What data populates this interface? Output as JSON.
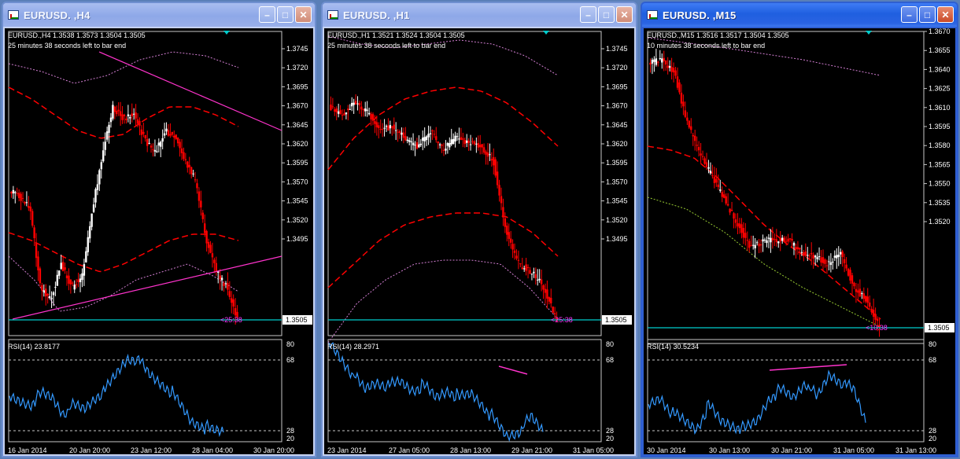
{
  "windows": [
    {
      "title": "EURUSD. ,H4",
      "active": false,
      "ohlc": "EURUSD.,H4  1.3538 1.3573 1.3504 1.3505",
      "status": "25 minutes 38 seconds left to bar end",
      "price_label": "1.3505",
      "timer": "<25:38",
      "rsi_label": "RSI(14) 23.8177",
      "rsi_levels": [
        "80",
        "68",
        "28",
        "20"
      ],
      "price_ticks": [
        "1.3745",
        "1.3720",
        "1.3695",
        "1.3670",
        "1.3645",
        "1.3620",
        "1.3595",
        "1.3570",
        "1.3545",
        "1.3520",
        "1.3495"
      ],
      "time_ticks": [
        "16 Jan 2014",
        "20 Jan 20:00",
        "23 Jan 12:00",
        "28 Jan 04:00",
        "30 Jan 20:00"
      ]
    },
    {
      "title": "EURUSD. ,H1",
      "active": false,
      "ohlc": "EURUSD.,H1  1.3521 1.3524 1.3504 1.3505",
      "status": "25 minutes 38 seconds left to bar end",
      "price_label": "1.3505",
      "timer": "<25:38",
      "rsi_label": "RSI(14) 28.2971",
      "rsi_levels": [
        "80",
        "68",
        "28",
        "20"
      ],
      "price_ticks": [
        "1.3745",
        "1.3720",
        "1.3695",
        "1.3670",
        "1.3645",
        "1.3620",
        "1.3595",
        "1.3570",
        "1.3545",
        "1.3520",
        "1.3495"
      ],
      "time_ticks": [
        "23 Jan 2014",
        "27 Jan 05:00",
        "28 Jan 13:00",
        "29 Jan 21:00",
        "31 Jan 05:00"
      ]
    },
    {
      "title": "EURUSD. ,M15",
      "active": true,
      "ohlc": "EURUSD.,M15  1.3516 1.3517 1.3504 1.3505",
      "status": "10 minutes 38 seconds left to bar end",
      "price_label": "1.3505",
      "timer": "<10:38",
      "rsi_label": "RSI(14) 30.5234",
      "rsi_levels": [
        "80",
        "68",
        "28",
        "20"
      ],
      "price_ticks": [
        "1.3670",
        "1.3655",
        "1.3640",
        "1.3625",
        "1.3610",
        "1.3595",
        "1.3580",
        "1.3565",
        "1.3550",
        "1.3535",
        "1.3520"
      ],
      "time_ticks": [
        "30 Jan 2014",
        "30 Jan 13:00",
        "30 Jan 21:00",
        "31 Jan 05:00",
        "31 Jan 13:00"
      ]
    }
  ],
  "colors": {
    "bull": "#ffffff",
    "bear": "#ff0000",
    "bid_line": "#00cccc",
    "envelope": "#ff0000",
    "outer_band": "#d47fd4",
    "lower_band": "#99cc33",
    "trendline": "#ff33cc",
    "rsi": "#3399ff",
    "timer": "#ff33ff"
  }
}
